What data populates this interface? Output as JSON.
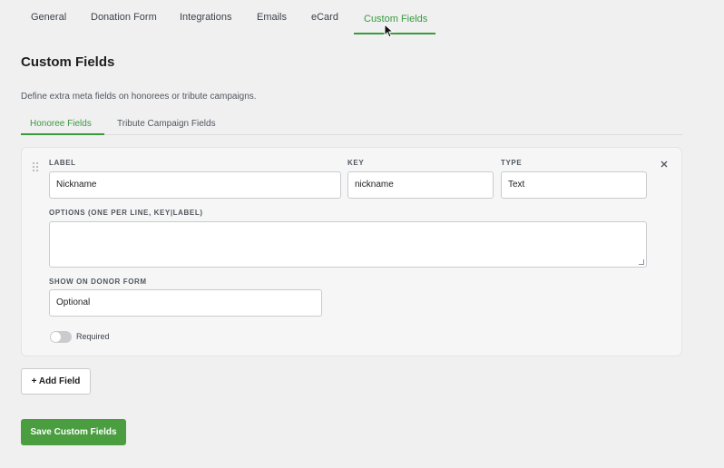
{
  "tabs": [
    {
      "label": "General"
    },
    {
      "label": "Donation Form"
    },
    {
      "label": "Integrations"
    },
    {
      "label": "Emails"
    },
    {
      "label": "eCard"
    },
    {
      "label": "Custom Fields"
    }
  ],
  "active_tab": "Custom Fields",
  "page": {
    "title": "Custom Fields",
    "description": "Define extra meta fields on honorees or tribute campaigns."
  },
  "subtabs": [
    {
      "label": "Honoree Fields"
    },
    {
      "label": "Tribute Campaign Fields"
    }
  ],
  "active_subtab": "Honoree Fields",
  "field_card": {
    "label_label": "LABEL",
    "label_value": "Nickname",
    "key_label": "KEY",
    "key_value": "nickname",
    "type_label": "TYPE",
    "type_value": "Text",
    "options_label": "OPTIONS (ONE PER LINE, KEY|LABEL)",
    "options_value": "",
    "show_label": "SHOW ON DONOR FORM",
    "show_value": "Optional",
    "required_label": "Required",
    "required_on": false
  },
  "buttons": {
    "add_field": "+ Add Field",
    "save": "Save Custom Fields"
  },
  "colors": {
    "accent": "#3a9a3e",
    "save_button": "#4a9e40"
  }
}
